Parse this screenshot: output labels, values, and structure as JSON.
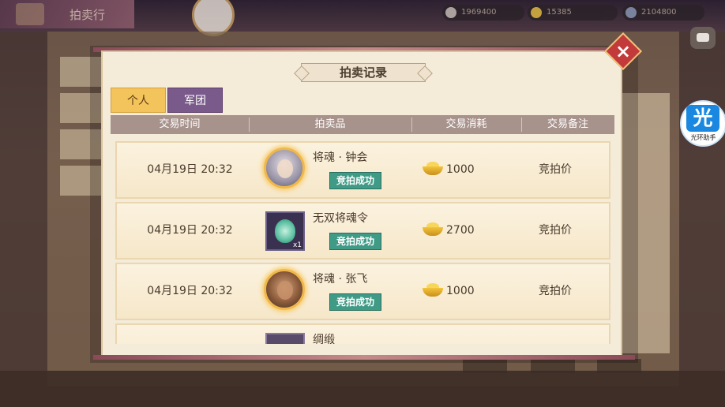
{
  "background": {
    "title": "拍卖行",
    "resources": [
      "1969400",
      "15385",
      "2104800"
    ]
  },
  "dialog": {
    "title": "拍卖记录",
    "tabs": [
      {
        "label": "个人",
        "active": true
      },
      {
        "label": "军团",
        "active": false
      }
    ],
    "columns": [
      "交易时间",
      "拍卖品",
      "交易消耗",
      "交易备注"
    ],
    "records": [
      {
        "time": "04月19日 20:32",
        "item": "将魂 · 钟会",
        "icon": "zhong-hui-portrait",
        "quantity": "",
        "status": "竞拍成功",
        "cost": "1000",
        "note": "竞拍价"
      },
      {
        "time": "04月19日 20:32",
        "item": "无双将魂令",
        "icon": "jade-token-icon",
        "quantity": "x1",
        "status": "竞拍成功",
        "cost": "2700",
        "note": "竞拍价"
      },
      {
        "time": "04月19日 20:32",
        "item": "将魂 · 张飞",
        "icon": "zhang-fei-portrait",
        "quantity": "",
        "status": "竞拍成功",
        "cost": "1000",
        "note": "竞拍价"
      },
      {
        "time": "",
        "item": "绸缎",
        "icon": "silk-item-icon",
        "quantity": "",
        "status": "",
        "cost": "",
        "note": ""
      }
    ]
  },
  "helper": {
    "glyph": "光",
    "label": "光环助手"
  },
  "colors": {
    "tab_active": "#f3c35c",
    "tab_inactive": "#7a5a8a",
    "status_badge": "#3f9a86",
    "close_button": "#c23a3a",
    "header_bar": "#a8928c"
  }
}
